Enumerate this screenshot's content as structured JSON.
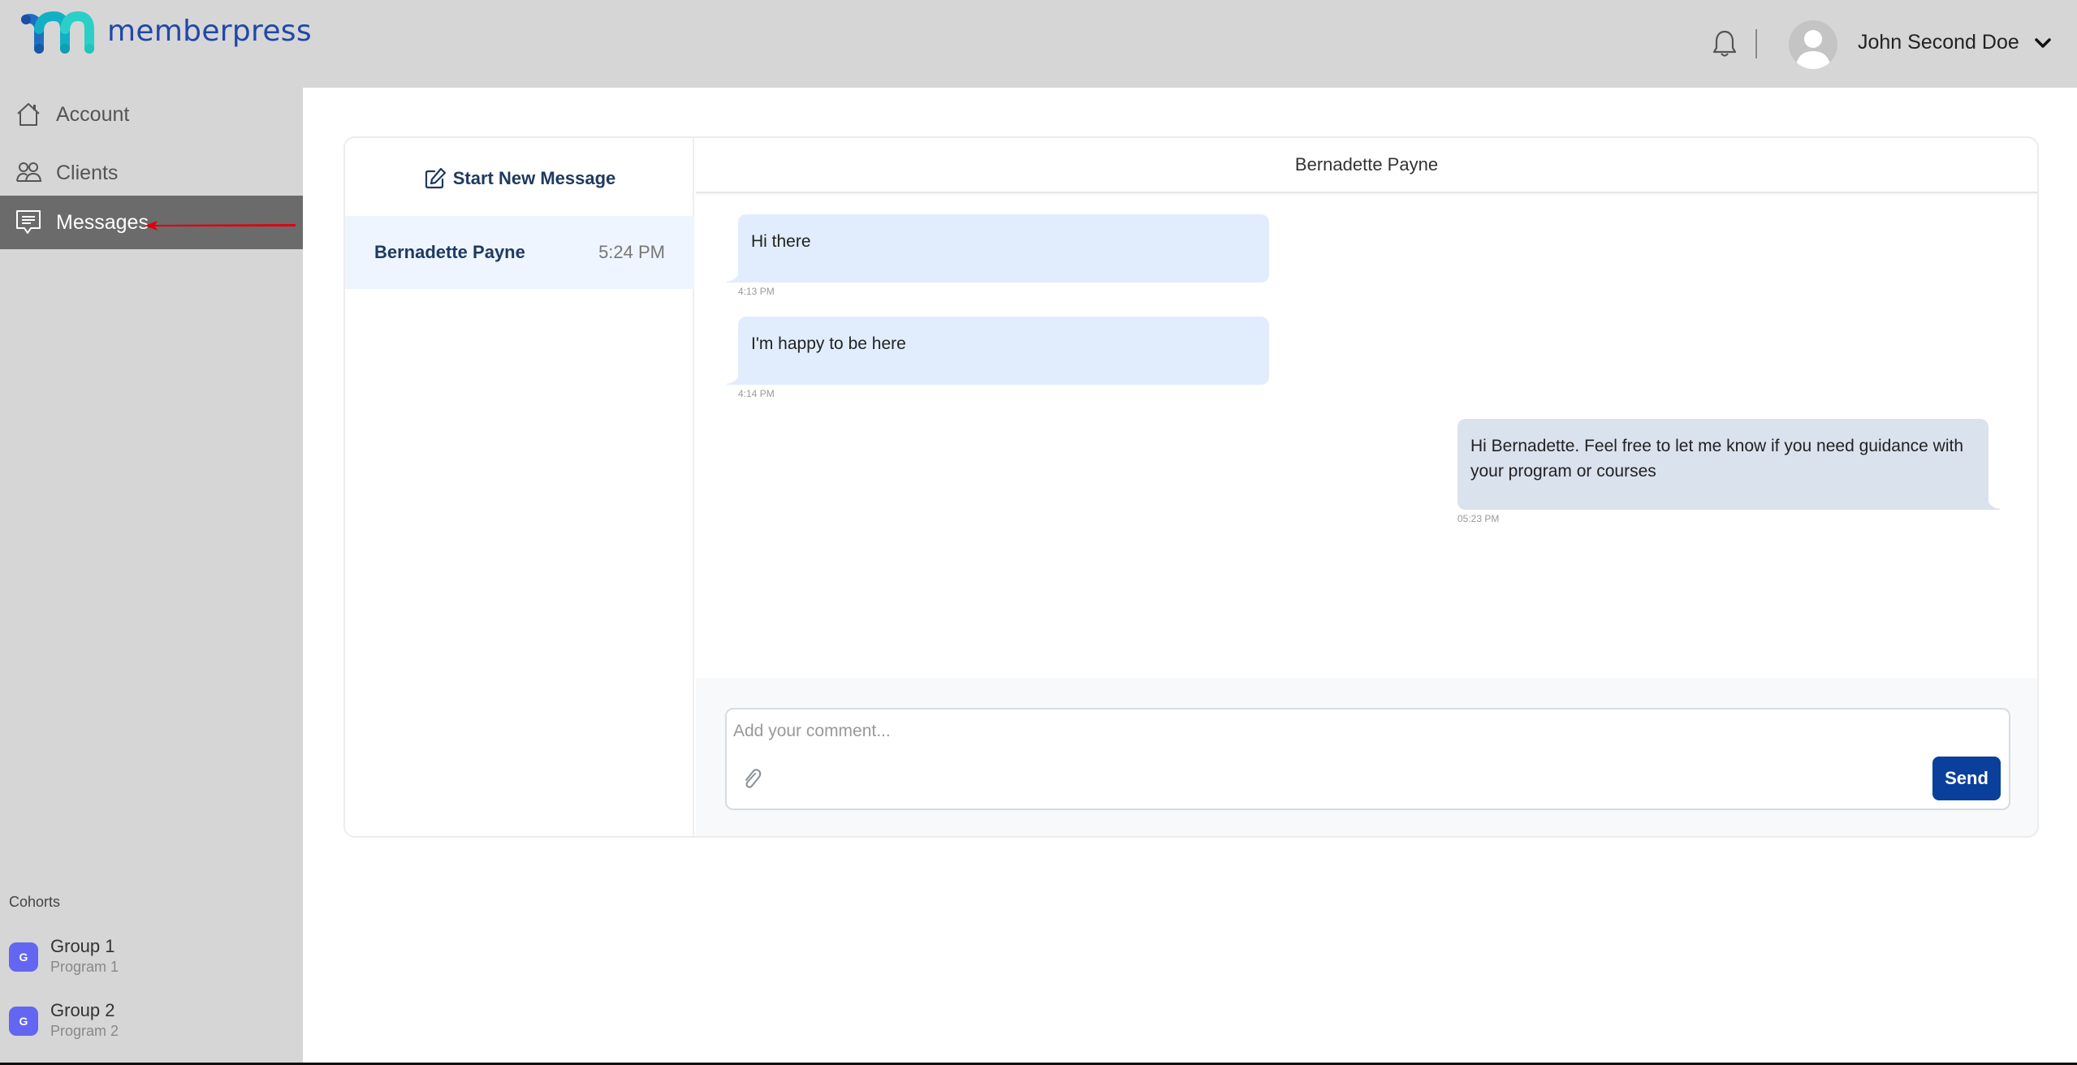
{
  "brand": {
    "name": "memberpress"
  },
  "header": {
    "notifications_icon": "bell-icon",
    "user_name": "John Second Doe",
    "menu_icon": "chevron-down-icon"
  },
  "sidebar": {
    "items": [
      {
        "label": "Account",
        "icon": "home-icon",
        "active": false
      },
      {
        "label": "Clients",
        "icon": "users-icon",
        "active": false
      },
      {
        "label": "Messages",
        "icon": "message-icon",
        "active": true
      }
    ],
    "cohorts_title": "Cohorts",
    "cohorts": [
      {
        "badge": "G",
        "name": "Group 1",
        "program": "Program 1"
      },
      {
        "badge": "G",
        "name": "Group 2",
        "program": "Program 2"
      }
    ]
  },
  "annotation": {
    "arrow_color": "#e0000b",
    "points_to": "Messages"
  },
  "conversations": {
    "new_message_label": "Start New Message",
    "items": [
      {
        "name": "Bernadette Payne",
        "time": "5:24 PM",
        "selected": true
      }
    ]
  },
  "chat": {
    "title": "Bernadette Payne",
    "messages": [
      {
        "direction": "incoming",
        "text": "Hi there",
        "time": "4:13 PM"
      },
      {
        "direction": "incoming",
        "text": "I'm happy to be here",
        "time": "4:14 PM"
      },
      {
        "direction": "outgoing",
        "text": "Hi Bernadette. Feel free to let me know if you need guidance with your program or courses",
        "time": "05:23 PM"
      }
    ],
    "composer": {
      "placeholder": "Add your comment...",
      "value": "",
      "attach_icon": "paperclip-icon",
      "send_label": "Send"
    }
  },
  "colors": {
    "header_bg": "#d6d6d6",
    "active_nav_bg": "#6b6b6b",
    "send_button": "#0a409c",
    "incoming_bubble": "#e1edfc",
    "outgoing_bubble": "#dae2ee",
    "cohort_badge": "#6366f1"
  }
}
